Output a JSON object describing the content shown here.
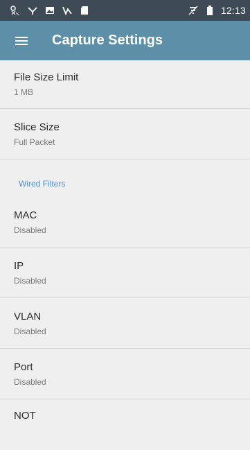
{
  "status_bar": {
    "time": "12:13",
    "left_icons": [
      "battery-100-icon",
      "shuffle-icon",
      "image-icon",
      "signal-strength-icon",
      "sd-card-icon"
    ],
    "right_icons": [
      "wifi-off-icon",
      "battery-icon"
    ]
  },
  "app_bar": {
    "title": "Capture Settings",
    "menu_icon": "hamburger-menu-icon"
  },
  "settings": [
    {
      "title": "File Size Limit",
      "value": "1 MB"
    },
    {
      "title": "Slice Size",
      "value": "Full Packet"
    }
  ],
  "wired_filters": {
    "header": "Wired Filters",
    "items": [
      {
        "title": "MAC",
        "value": "Disabled"
      },
      {
        "title": "IP",
        "value": "Disabled"
      },
      {
        "title": "VLAN",
        "value": "Disabled"
      },
      {
        "title": "Port",
        "value": "Disabled"
      },
      {
        "title": "NOT",
        "value": ""
      }
    ]
  },
  "colors": {
    "status_bar": "#3e4a55",
    "app_bar": "#5e8fa8",
    "background": "#efefef",
    "section_header": "#4a90e2"
  }
}
